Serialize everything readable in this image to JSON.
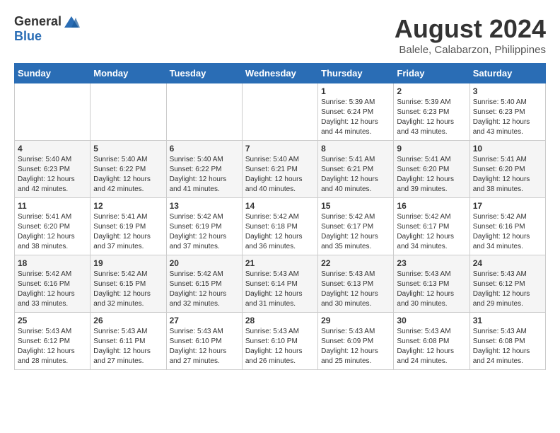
{
  "header": {
    "logo_general": "General",
    "logo_blue": "Blue",
    "month_year": "August 2024",
    "location": "Balele, Calabarzon, Philippines"
  },
  "days_of_week": [
    "Sunday",
    "Monday",
    "Tuesday",
    "Wednesday",
    "Thursday",
    "Friday",
    "Saturday"
  ],
  "weeks": [
    [
      {
        "day": "",
        "info": ""
      },
      {
        "day": "",
        "info": ""
      },
      {
        "day": "",
        "info": ""
      },
      {
        "day": "",
        "info": ""
      },
      {
        "day": "1",
        "info": "Sunrise: 5:39 AM\nSunset: 6:24 PM\nDaylight: 12 hours\nand 44 minutes."
      },
      {
        "day": "2",
        "info": "Sunrise: 5:39 AM\nSunset: 6:23 PM\nDaylight: 12 hours\nand 43 minutes."
      },
      {
        "day": "3",
        "info": "Sunrise: 5:40 AM\nSunset: 6:23 PM\nDaylight: 12 hours\nand 43 minutes."
      }
    ],
    [
      {
        "day": "4",
        "info": "Sunrise: 5:40 AM\nSunset: 6:23 PM\nDaylight: 12 hours\nand 42 minutes."
      },
      {
        "day": "5",
        "info": "Sunrise: 5:40 AM\nSunset: 6:22 PM\nDaylight: 12 hours\nand 42 minutes."
      },
      {
        "day": "6",
        "info": "Sunrise: 5:40 AM\nSunset: 6:22 PM\nDaylight: 12 hours\nand 41 minutes."
      },
      {
        "day": "7",
        "info": "Sunrise: 5:40 AM\nSunset: 6:21 PM\nDaylight: 12 hours\nand 40 minutes."
      },
      {
        "day": "8",
        "info": "Sunrise: 5:41 AM\nSunset: 6:21 PM\nDaylight: 12 hours\nand 40 minutes."
      },
      {
        "day": "9",
        "info": "Sunrise: 5:41 AM\nSunset: 6:20 PM\nDaylight: 12 hours\nand 39 minutes."
      },
      {
        "day": "10",
        "info": "Sunrise: 5:41 AM\nSunset: 6:20 PM\nDaylight: 12 hours\nand 38 minutes."
      }
    ],
    [
      {
        "day": "11",
        "info": "Sunrise: 5:41 AM\nSunset: 6:20 PM\nDaylight: 12 hours\nand 38 minutes."
      },
      {
        "day": "12",
        "info": "Sunrise: 5:41 AM\nSunset: 6:19 PM\nDaylight: 12 hours\nand 37 minutes."
      },
      {
        "day": "13",
        "info": "Sunrise: 5:42 AM\nSunset: 6:19 PM\nDaylight: 12 hours\nand 37 minutes."
      },
      {
        "day": "14",
        "info": "Sunrise: 5:42 AM\nSunset: 6:18 PM\nDaylight: 12 hours\nand 36 minutes."
      },
      {
        "day": "15",
        "info": "Sunrise: 5:42 AM\nSunset: 6:17 PM\nDaylight: 12 hours\nand 35 minutes."
      },
      {
        "day": "16",
        "info": "Sunrise: 5:42 AM\nSunset: 6:17 PM\nDaylight: 12 hours\nand 34 minutes."
      },
      {
        "day": "17",
        "info": "Sunrise: 5:42 AM\nSunset: 6:16 PM\nDaylight: 12 hours\nand 34 minutes."
      }
    ],
    [
      {
        "day": "18",
        "info": "Sunrise: 5:42 AM\nSunset: 6:16 PM\nDaylight: 12 hours\nand 33 minutes."
      },
      {
        "day": "19",
        "info": "Sunrise: 5:42 AM\nSunset: 6:15 PM\nDaylight: 12 hours\nand 32 minutes."
      },
      {
        "day": "20",
        "info": "Sunrise: 5:42 AM\nSunset: 6:15 PM\nDaylight: 12 hours\nand 32 minutes."
      },
      {
        "day": "21",
        "info": "Sunrise: 5:43 AM\nSunset: 6:14 PM\nDaylight: 12 hours\nand 31 minutes."
      },
      {
        "day": "22",
        "info": "Sunrise: 5:43 AM\nSunset: 6:13 PM\nDaylight: 12 hours\nand 30 minutes."
      },
      {
        "day": "23",
        "info": "Sunrise: 5:43 AM\nSunset: 6:13 PM\nDaylight: 12 hours\nand 30 minutes."
      },
      {
        "day": "24",
        "info": "Sunrise: 5:43 AM\nSunset: 6:12 PM\nDaylight: 12 hours\nand 29 minutes."
      }
    ],
    [
      {
        "day": "25",
        "info": "Sunrise: 5:43 AM\nSunset: 6:12 PM\nDaylight: 12 hours\nand 28 minutes."
      },
      {
        "day": "26",
        "info": "Sunrise: 5:43 AM\nSunset: 6:11 PM\nDaylight: 12 hours\nand 27 minutes."
      },
      {
        "day": "27",
        "info": "Sunrise: 5:43 AM\nSunset: 6:10 PM\nDaylight: 12 hours\nand 27 minutes."
      },
      {
        "day": "28",
        "info": "Sunrise: 5:43 AM\nSunset: 6:10 PM\nDaylight: 12 hours\nand 26 minutes."
      },
      {
        "day": "29",
        "info": "Sunrise: 5:43 AM\nSunset: 6:09 PM\nDaylight: 12 hours\nand 25 minutes."
      },
      {
        "day": "30",
        "info": "Sunrise: 5:43 AM\nSunset: 6:08 PM\nDaylight: 12 hours\nand 24 minutes."
      },
      {
        "day": "31",
        "info": "Sunrise: 5:43 AM\nSunset: 6:08 PM\nDaylight: 12 hours\nand 24 minutes."
      }
    ]
  ]
}
